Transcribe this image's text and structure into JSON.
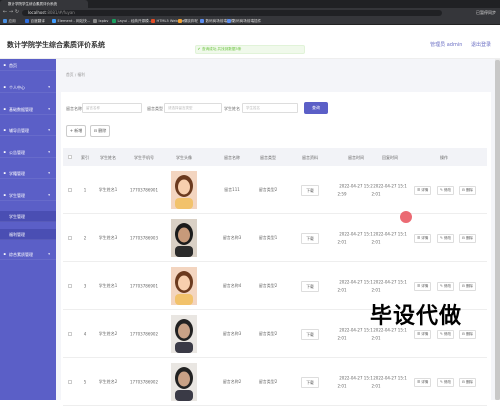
{
  "browser": {
    "tab_title": "数计学院学生综合素质评价系统",
    "url_host": "localhost",
    "url_path": ":8081/#/fuyan",
    "profile": "已暂停同步",
    "bookmarks": [
      {
        "label": "应用",
        "color": "#4a90e2"
      },
      {
        "label": "百度翻译",
        "color": "#2f6fe0"
      },
      {
        "label": "Element - 网站快...",
        "color": "#409eff"
      },
      {
        "label": "lxpbv",
        "color": "#888888"
      },
      {
        "label": "Layui - 经典开源模...",
        "color": "#19a15f"
      },
      {
        "label": "HTML5 Website T...",
        "color": "#e44d26"
      },
      {
        "label": "废放弃呢",
        "color": "#f0a030"
      },
      {
        "label": "数码商场前端插件",
        "color": "#5b8def"
      },
      {
        "label": "数码商场前端插件",
        "color": "#5b8def"
      }
    ]
  },
  "header": {
    "title": "数计学院学生综合素质评价系统",
    "admin_label": "管理员 admin",
    "logout_label": "退出登录"
  },
  "toast": "查询成功,共找到数据5条",
  "sidebar": {
    "items": [
      {
        "label": "首页",
        "arrow": ""
      },
      {
        "label": "个人中心",
        "arrow": "▾"
      },
      {
        "label": "基础数据管理",
        "arrow": "▾"
      },
      {
        "label": "辅导员管理",
        "arrow": "▾"
      },
      {
        "label": "公告管理",
        "arrow": "▾"
      },
      {
        "label": "学籍管理",
        "arrow": "▾"
      },
      {
        "label": "学生管理",
        "arrow": "▾"
      },
      {
        "label": "学生管理",
        "arrow": "",
        "sub": true
      },
      {
        "label": "福利管理",
        "arrow": "",
        "sub": true
      },
      {
        "label": "综合素质管理",
        "arrow": "▾"
      }
    ]
  },
  "breadcrumb": {
    "home": "首页",
    "sep": "/",
    "current": "福利"
  },
  "filters": {
    "name_label": "留言名称",
    "name_placeholder": "留言名称",
    "type_label": "留言类型",
    "type_placeholder": "请选择留言类型",
    "student_label": "学生姓名",
    "student_placeholder": "学生姓名",
    "search_label": "查询"
  },
  "actions": {
    "add": "+ 新增",
    "delete": "⊟ 删除"
  },
  "table": {
    "columns": [
      "索引",
      "学生姓名",
      "学生手机号",
      "学生头像",
      "留言名称",
      "留言类型",
      "留言资料",
      "留言时间",
      "回复时间",
      "操作"
    ],
    "download_label": "下载",
    "op_detail": "☰ 详情",
    "op_edit": "✎ 修改",
    "op_delete": "⊟ 删除",
    "rows": [
      {
        "index": "1",
        "name": "学生姓名1",
        "phone": "17703786901",
        "photo": "girl",
        "msg_name": "留言111",
        "msg_type": "留言类型2",
        "msg_time_1": "2022-04-27 15:2",
        "msg_time_2": "2:59",
        "reply_1": "2022-04-27 15:1",
        "reply_2": "2:01"
      },
      {
        "index": "2",
        "name": "学生姓名3",
        "phone": "17703786903",
        "photo": "boy",
        "msg_name": "留言名称3",
        "msg_type": "留言类型1",
        "msg_time_1": "2022-04-27 15:1",
        "msg_time_2": "2:01",
        "reply_1": "2022-04-27 15:1",
        "reply_2": "2:01"
      },
      {
        "index": "3",
        "name": "学生姓名1",
        "phone": "17703786901",
        "photo": "girl",
        "msg_name": "留言名称4",
        "msg_type": "留言类型2",
        "msg_time_1": "2022-04-27 15:1",
        "msg_time_2": "2:01",
        "reply_1": "2022-04-27 15:1",
        "reply_2": "2:01"
      },
      {
        "index": "4",
        "name": "学生姓名2",
        "phone": "17703786902",
        "photo": "man",
        "msg_name": "留言名称3",
        "msg_type": "留言类型2",
        "msg_time_1": "2022-04-27 15:1",
        "msg_time_2": "2:01",
        "reply_1": "2022-04-27 15:1",
        "reply_2": "2:01"
      },
      {
        "index": "5",
        "name": "学生姓名2",
        "phone": "17703786902",
        "photo": "man",
        "msg_name": "留言名称2",
        "msg_type": "留言类型2",
        "msg_time_1": "2022-04-27 15:1",
        "msg_time_2": "2:01",
        "reply_1": "2022-04-27 15:1",
        "reply_2": "2:01"
      }
    ]
  },
  "watermark": "毕设代做",
  "colors": {
    "sidebar": "#5b5fc7",
    "accent": "#5b5fc7",
    "toast": "#67c23a"
  }
}
